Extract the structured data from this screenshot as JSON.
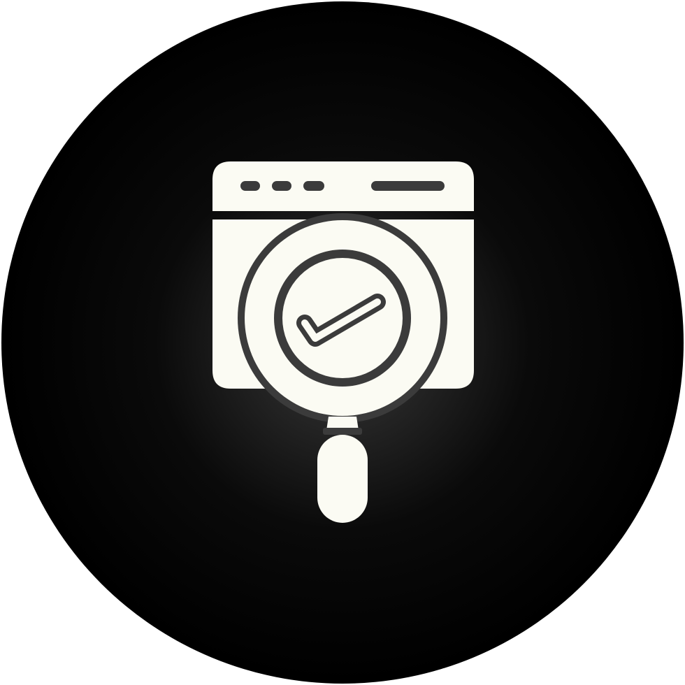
{
  "icon": {
    "name": "website-verified-search-icon",
    "parts": [
      "circle-badge",
      "browser-window-icon",
      "magnifying-glass-icon",
      "checkmark-icon"
    ]
  },
  "colors": {
    "background": "#ffffff",
    "badge_center": "#3a3a3a",
    "badge_mid": "#0a0a0a",
    "badge_edge": "#000000",
    "glyph": "#fbfbf3",
    "detail": "#3b3b3b"
  }
}
